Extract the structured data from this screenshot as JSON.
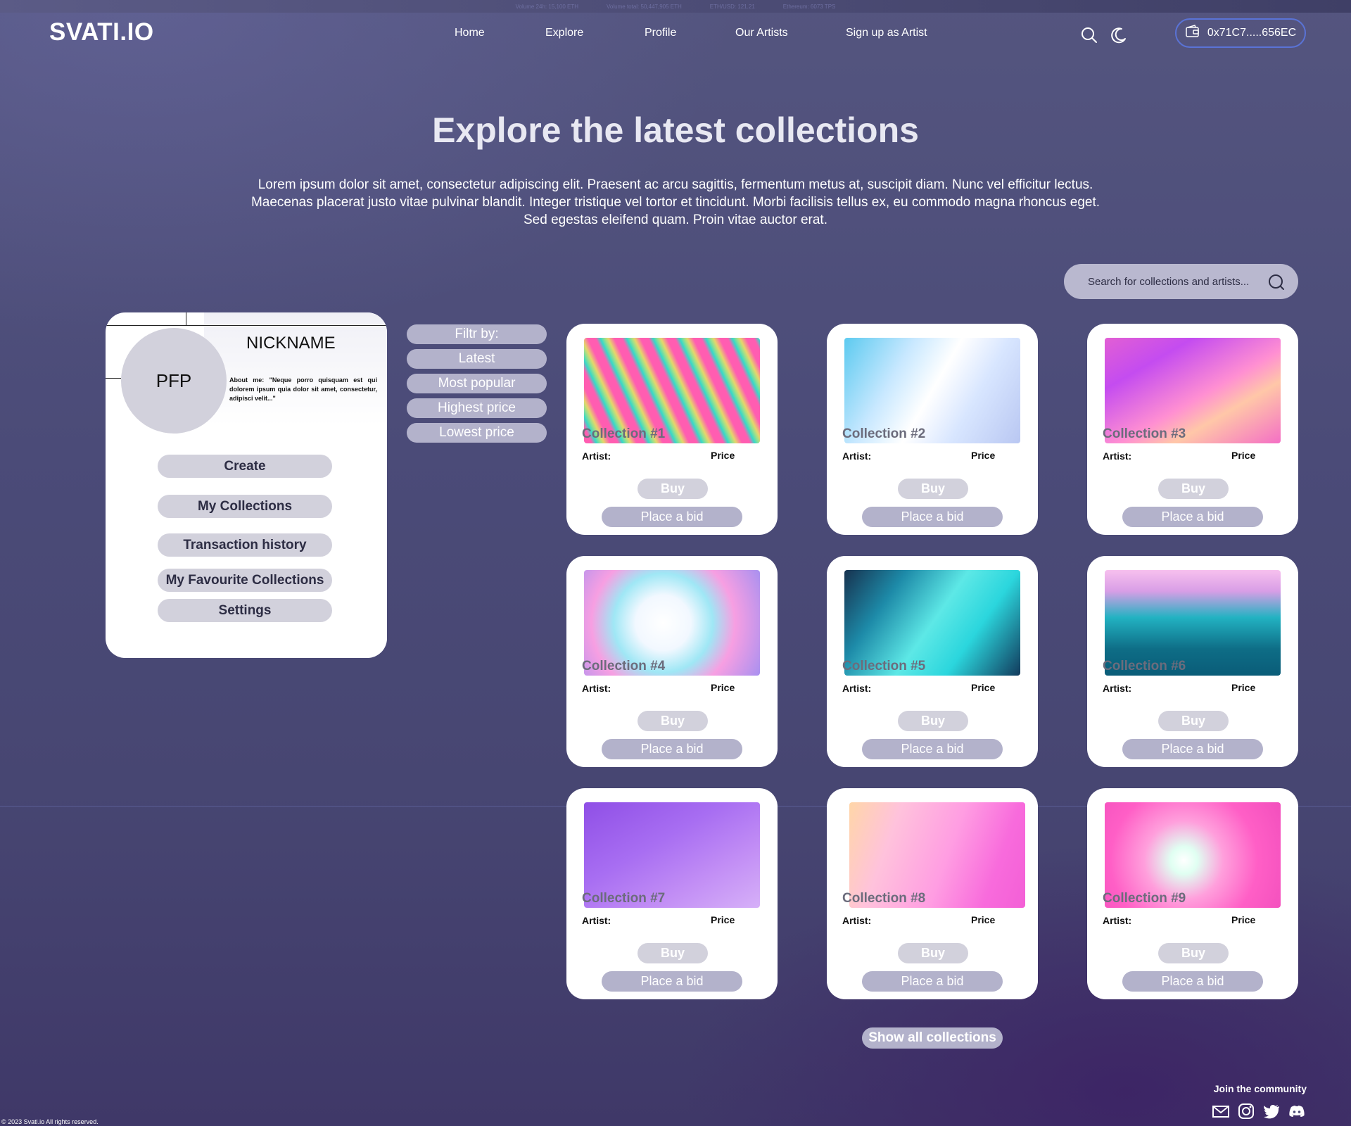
{
  "ticker": [
    "Volume 24h: 15,100 ETH",
    "Volume total: 50,447,905 ETH",
    "ETH/USD: 121.21",
    "Ethereum: 6073 TPS"
  ],
  "brand": {
    "logo": "SVATI.IO"
  },
  "nav": [
    {
      "label": "Home"
    },
    {
      "label": "Explore"
    },
    {
      "label": "Profile"
    },
    {
      "label": "Our Artists"
    },
    {
      "label": "Sign up as Artist"
    }
  ],
  "header_icons": [
    "search-icon",
    "moon-icon",
    "wallet-icon"
  ],
  "wallet": {
    "address": "0x71C7.....656EC"
  },
  "hero": {
    "title": "Explore the latest collections",
    "intro": [
      "Lorem ipsum dolor sit amet, consectetur adipiscing elit. Praesent ac arcu sagittis, fermentum metus at, suscipit diam. Nunc vel efficitur lectus.",
      "Maecenas placerat justo vitae pulvinar blandit. Integer tristique vel tortor et tincidunt. Morbi facilisis tellus ex, eu commodo magna rhoncus eget.",
      "Sed egestas eleifend quam. Proin vitae auctor erat."
    ]
  },
  "search": {
    "placeholder": "Search for collections and artists..."
  },
  "profile": {
    "pfp": "PFP",
    "nickname": "NICKNAME",
    "about": "About me: \"Neque porro quisquam est qui dolorem ipsum quia dolor sit amet, consectetur, adipisci velit...\"",
    "buttons": [
      "Create",
      "My  Collections",
      "Transaction history",
      "My Favourite Collections",
      "Settings"
    ]
  },
  "filters": {
    "heading": "Filtr by:",
    "options": [
      "Latest",
      "Most popular",
      "Highest price",
      "Lowest price"
    ]
  },
  "cards": [
    {
      "name": "Collection #1",
      "artist": "Artist:",
      "price": "Price",
      "buy": "Buy",
      "bid": "Place a bid"
    },
    {
      "name": "Collection #2",
      "artist": "Artist:",
      "price": "Price",
      "buy": "Buy",
      "bid": "Place a bid"
    },
    {
      "name": "Collection #3",
      "artist": "Artist:",
      "price": "Price",
      "buy": "Buy",
      "bid": "Place a bid"
    },
    {
      "name": "Collection #4",
      "artist": "Artist:",
      "price": "Price",
      "buy": "Buy",
      "bid": "Place a bid"
    },
    {
      "name": "Collection #5",
      "artist": "Artist:",
      "price": "Price",
      "buy": "Buy",
      "bid": "Place a bid"
    },
    {
      "name": "Collection #6",
      "artist": "Artist:",
      "price": "Price",
      "buy": "Buy",
      "bid": "Place a bid"
    },
    {
      "name": "Collection #7",
      "artist": "Artist:",
      "price": "Price",
      "buy": "Buy",
      "bid": "Place a bid"
    },
    {
      "name": "Collection #8",
      "artist": "Artist:",
      "price": "Price",
      "buy": "Buy",
      "bid": "Place a bid"
    },
    {
      "name": "Collection #9",
      "artist": "Artist:",
      "price": "Price",
      "buy": "Buy",
      "bid": "Place a bid"
    }
  ],
  "show_all": "Show all collections",
  "footer": {
    "community": "Join the community",
    "social": [
      "mail-icon",
      "instagram-icon",
      "twitter-icon",
      "discord-icon"
    ],
    "copyright": "© 2023 Svati.io  All rights reserved."
  },
  "colors": {
    "accent_border": "#5a73d6",
    "button_light": "#d2d1dc",
    "button_dark": "#b3b2cb"
  }
}
